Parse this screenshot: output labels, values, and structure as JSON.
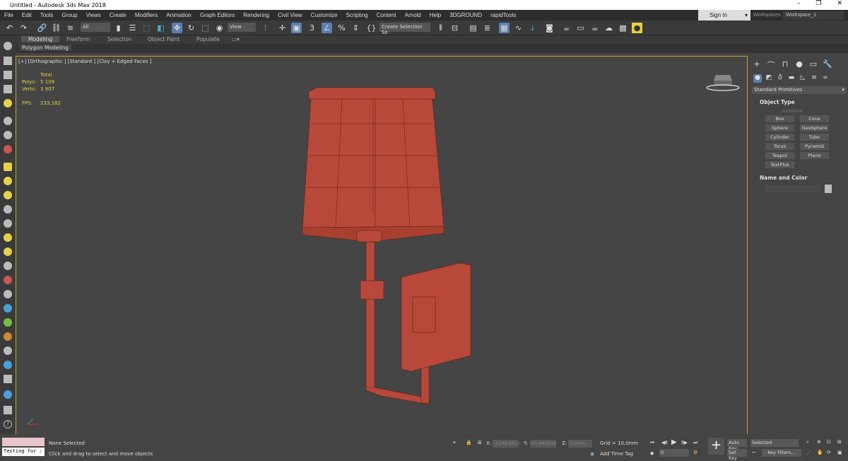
{
  "window": {
    "title": "Untitled - Autodesk 3ds Max 2018",
    "minimize": "–",
    "restore": "❐",
    "close": "✕"
  },
  "menu": [
    "File",
    "Edit",
    "Tools",
    "Group",
    "Views",
    "Create",
    "Modifiers",
    "Animation",
    "Graph Editors",
    "Rendering",
    "Civil View",
    "Customize",
    "Scripting",
    "Content",
    "Arnold",
    "Help",
    "3DGROUND",
    "rapidTools"
  ],
  "signin": "Sign In",
  "workspaces_label": "Workspaces:",
  "workspace": "Workspace_1",
  "toolbar": {
    "selection_filter": "All",
    "ref_coord": "View",
    "snap_angle": "3",
    "named_selection": "Create Selection Se"
  },
  "ribbon": {
    "tabs": [
      "Modeling",
      "Freeform",
      "Selection",
      "Object Paint",
      "Populate"
    ],
    "panel": "Polygon Modeling"
  },
  "viewport": {
    "label": "[+] [Orthographic ] [Standard ] [Clay + Edged Faces ]",
    "stats": {
      "total": "Total",
      "polys_label": "Polys:",
      "polys": "5 109",
      "verts_label": "Verts:",
      "verts": "3 907",
      "fps_label": "FPS:",
      "fps": "233,182"
    },
    "model_color": "#b8493a",
    "border_color": "#c9a13a"
  },
  "command_panel": {
    "dropdown": "Standard Primitives",
    "object_type": "Object Type",
    "autogrid": "AutoGrid",
    "buttons": [
      "Box",
      "Cone",
      "Sphere",
      "GeoSphere",
      "Cylinder",
      "Tube",
      "Torus",
      "Pyramid",
      "Teapot",
      "Plane",
      "TextPlus"
    ],
    "name_and_color": "Name and Color"
  },
  "status": {
    "script_input": "Testing for :",
    "selection": "None Selected",
    "prompt": "Click and drag to select and move objects",
    "x_label": "X:",
    "x": "-1140,681n",
    "y_label": "Y:",
    "y": "65,463mm",
    "z_label": "Z:",
    "z": "0,0mm",
    "grid": "Grid = 10,0mm",
    "add_time_tag": "Add Time Tag",
    "frame": "0",
    "auto_key": "Auto Key",
    "set_key": "Set Key",
    "key_mode": "Selected",
    "key_filters": "Key Filters..."
  }
}
